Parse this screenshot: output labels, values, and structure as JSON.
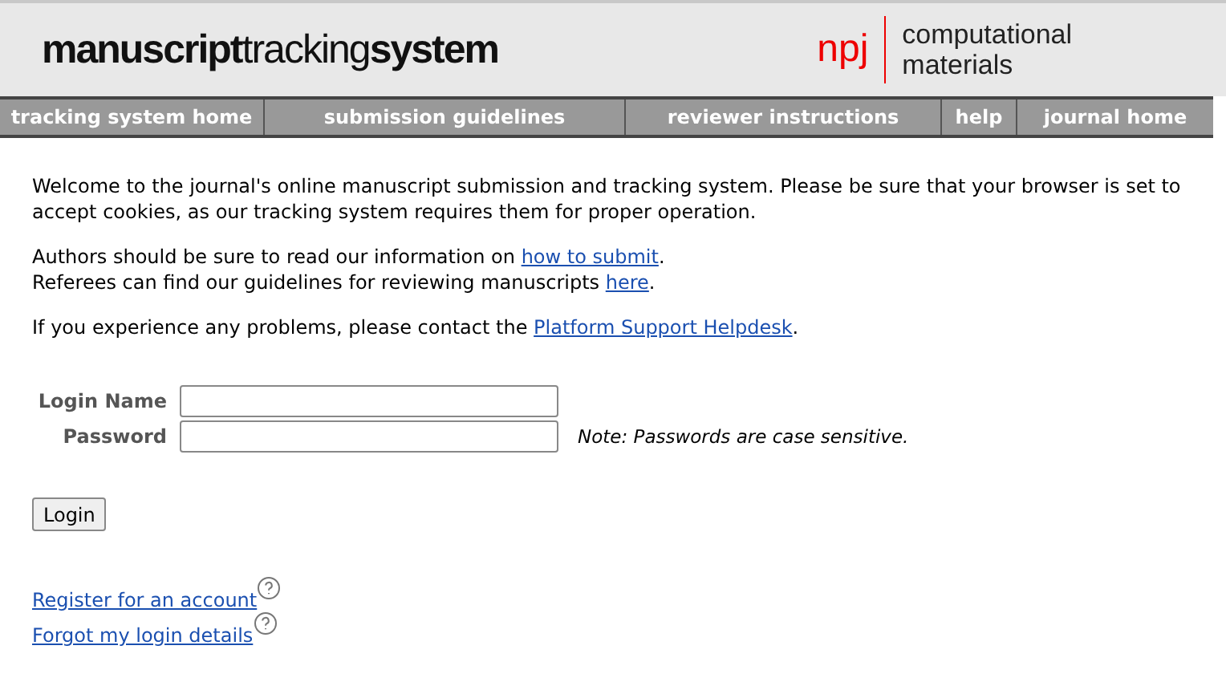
{
  "header": {
    "logo": "**manuscript**tracking**system**",
    "journal_mark": "npj",
    "journal_name": [
      "computational",
      "materials"
    ]
  },
  "nav": [
    {
      "label": "tracking system home"
    },
    {
      "label": "submission guidelines"
    },
    {
      "label": "reviewer instructions"
    },
    {
      "label": "help"
    },
    {
      "label": "journal home"
    }
  ],
  "intro": [
    {
      "lines": [
        {
          "before": "Welcome to the journal's online manuscript submission and tracking system. Please be sure that your browser is set to accept cookies, as our tracking system requires them for proper operation."
        }
      ]
    },
    {
      "lines": [
        {
          "before": "Authors should be sure to read our information on ",
          "link": "how to submit",
          "after": "."
        },
        {
          "before": "Referees can find our guidelines for reviewing manuscripts ",
          "link": "here",
          "after": "."
        }
      ]
    },
    {
      "lines": [
        {
          "before": "If you experience any problems, please contact the ",
          "link": "Platform Support Helpdesk",
          "after": "."
        }
      ]
    }
  ],
  "login": {
    "fields": [
      {
        "label": "Login Name"
      },
      {
        "label": "Password",
        "note": "Note: Passwords are case sensitive."
      }
    ],
    "button": "Login"
  },
  "links": [
    {
      "label": "Register for an account"
    },
    {
      "label": "Forgot my login details"
    }
  ]
}
